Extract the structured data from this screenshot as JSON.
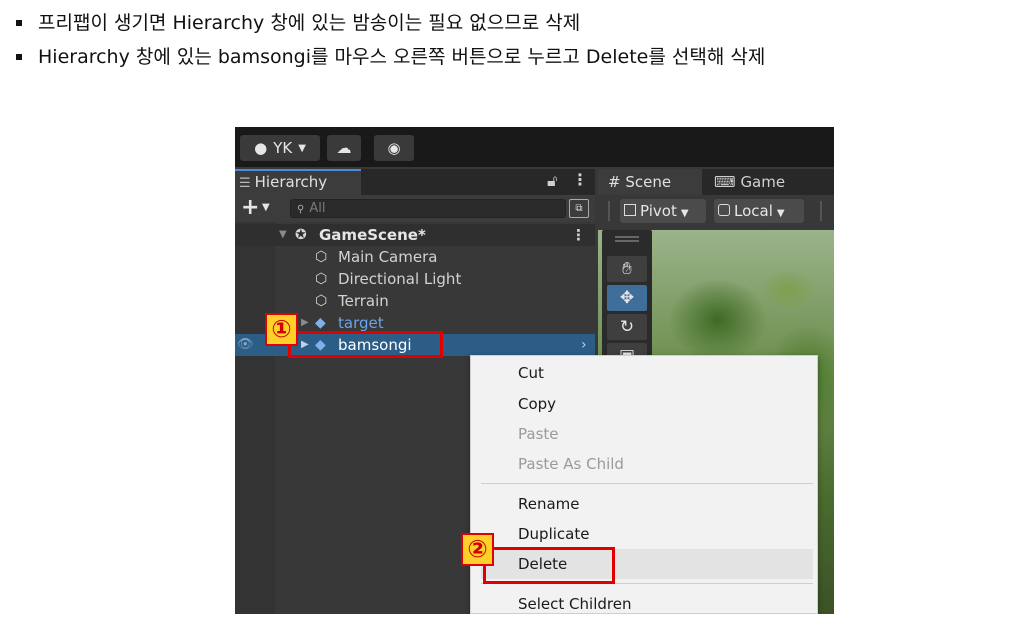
{
  "instructions": [
    "프리팹이 생기면 Hierarchy 창에 있는 밤송이는 필요 없으므로 삭제",
    "Hierarchy 창에 있는 bamsongi를 마우스 오른쪽 버튼으로 누르고 Delete를 선택해 삭제"
  ],
  "toolbar": {
    "account": "YK",
    "account_icon": "user-circle-icon",
    "cloud_icon": "cloud-icon",
    "collab_icon": "collab-icon"
  },
  "hierarchy": {
    "tab_label": "Hierarchy",
    "search_placeholder": "All",
    "scene": "GameScene*",
    "items": [
      "Main Camera",
      "Directional Light",
      "Terrain",
      "target",
      "bamsongi"
    ]
  },
  "scene_view": {
    "tabs": [
      "Scene",
      "Game"
    ],
    "pivot_label": "Pivot",
    "local_label": "Local",
    "tools": [
      "hand-icon",
      "move-icon",
      "rotate-icon",
      "scale-icon"
    ]
  },
  "context_menu": {
    "items": [
      "Cut",
      "Copy",
      "Paste",
      "Paste As Child",
      "Rename",
      "Duplicate",
      "Delete",
      "Select Children"
    ],
    "disabled": [
      "Paste",
      "Paste As Child"
    ],
    "highlighted": "Delete"
  },
  "callouts": {
    "step1": "①",
    "step2": "②"
  },
  "colors": {
    "selection": "#2c5d87",
    "callout_border": "#e00000",
    "badge_fill": "#ffd02a",
    "editor_bg": "#383838"
  }
}
